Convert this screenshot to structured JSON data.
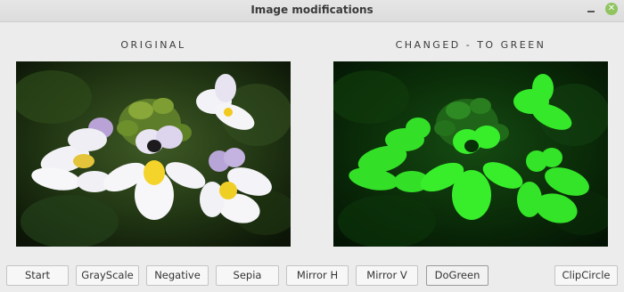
{
  "window": {
    "title": "Image modifications"
  },
  "panels": {
    "left_label": "ORIGINAL",
    "right_label": "CHANGED - TO GREEN"
  },
  "icons": {
    "minimize": "minimize-icon",
    "close": "close-icon"
  },
  "buttons": {
    "start": "Start",
    "grayscale": "GrayScale",
    "negative": "Negative",
    "sepia": "Sepia",
    "mirror_h": "Mirror H",
    "mirror_v": "Mirror V",
    "dogreen": "DoGreen",
    "clipcircle": "ClipCircle"
  },
  "colors": {
    "close_button": "#8fc460",
    "window_bg": "#ececec"
  }
}
